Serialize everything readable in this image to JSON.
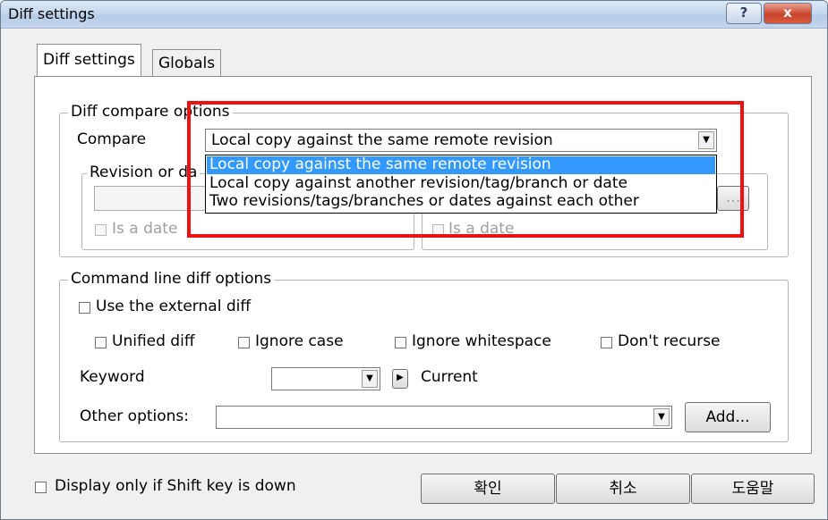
{
  "window": {
    "title": "Diff settings",
    "help_label": "?",
    "close_label": "x"
  },
  "tabs": [
    "Diff settings",
    "Globals"
  ],
  "compare_group": {
    "title": "Diff compare options",
    "compare_label": "Compare",
    "compare_value": "Local copy against the same remote revision",
    "options": [
      "Local copy against the same remote revision",
      "Local copy against another revision/tag/branch or date",
      "Two revisions/tags/branches or dates against each other"
    ],
    "revision_title_left": "Revision or da",
    "is_date_left": "Is a date",
    "is_date_right": "Is a date",
    "browse_right": "..."
  },
  "cmdline_group": {
    "title": "Command line diff options",
    "use_external": "Use the external diff",
    "unified": "Unified diff",
    "ignore_case": "Ignore case",
    "ignore_ws": "Ignore whitespace",
    "dont_recurse": "Don't recurse",
    "keyword_label": "Keyword",
    "keyword_value": "",
    "current_label": "Current",
    "other_label": "Other options:",
    "other_value": "",
    "add_label": "Add..."
  },
  "footer": {
    "shift_label": "Display only if Shift key is down",
    "ok_label": "확인",
    "cancel_label": "취소",
    "help_label": "도움말"
  }
}
